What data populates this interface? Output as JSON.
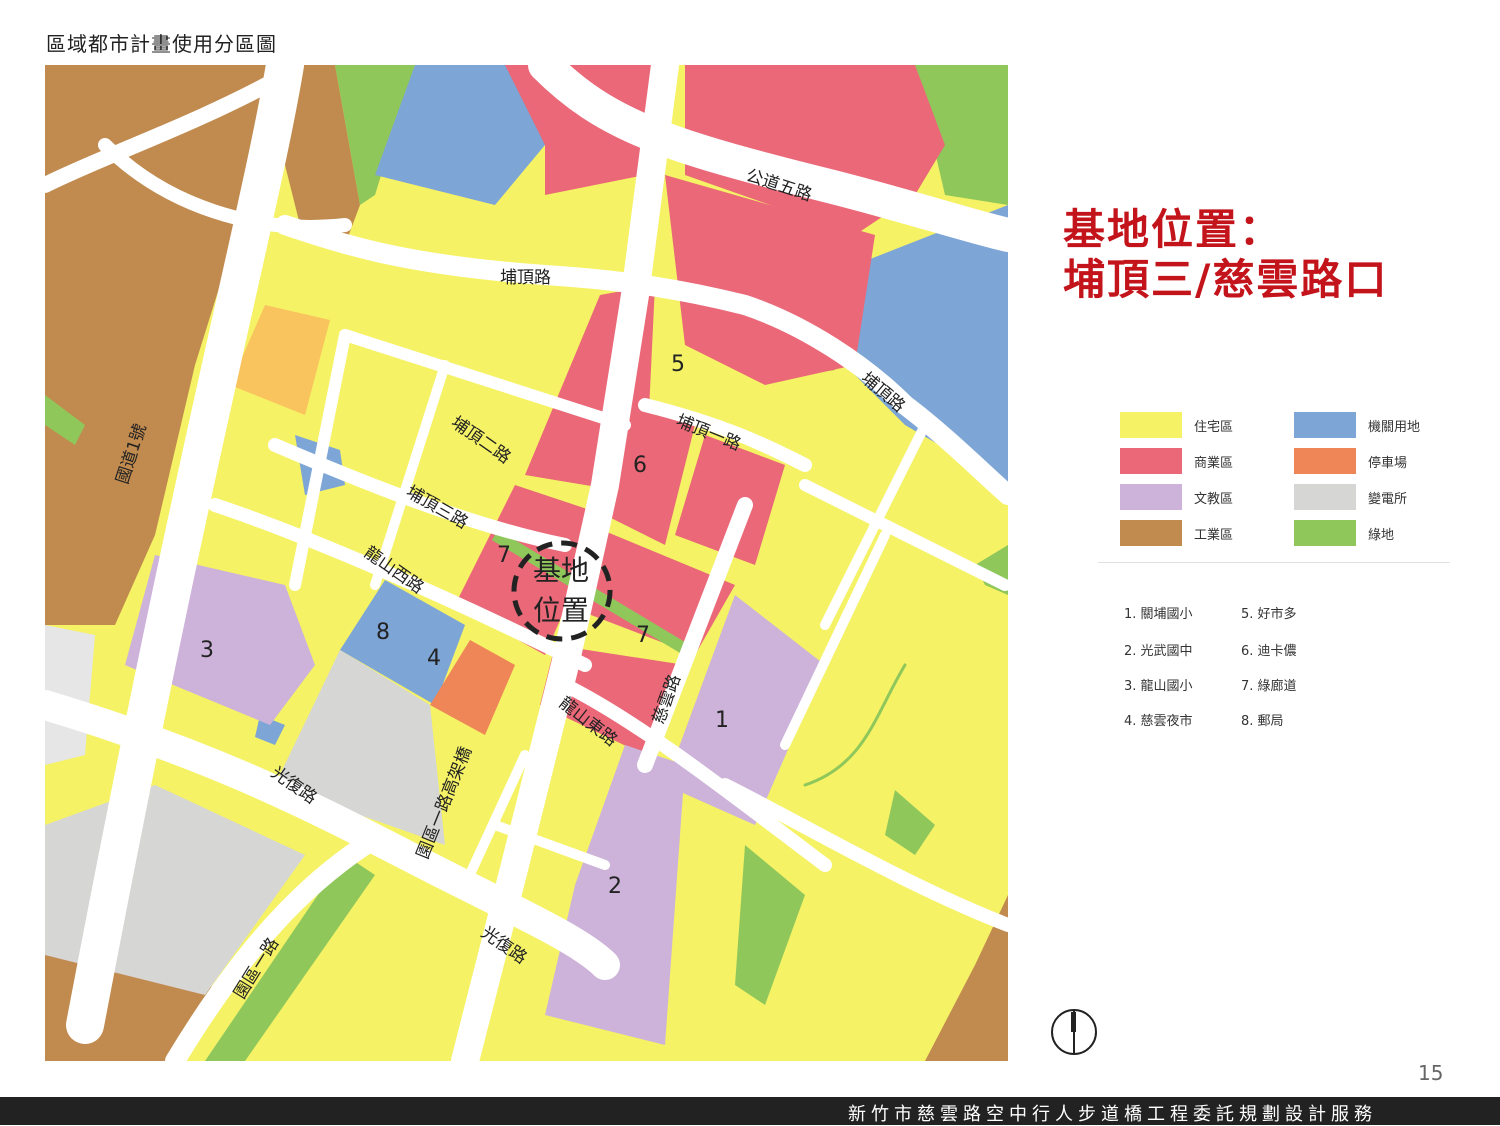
{
  "page_title": "區域都市計畫使用分區圖",
  "site": {
    "line1": "基地位置：",
    "line2": "埔頂三/慈雲路口",
    "map_line1": "基地",
    "map_line2": "位置"
  },
  "colors": {
    "residential": "#f5f266",
    "government": "#7da5d6",
    "commercial": "#ea6878",
    "parking": "#ef8657",
    "education": "#cdb3d9",
    "substation": "#d6d6d4",
    "industrial": "#c18a4e",
    "green": "#8fc75b",
    "road": "#ffffff",
    "orange_lot": "#f9c35e"
  },
  "legend": [
    {
      "label": "住宅區",
      "color": "#f5f266"
    },
    {
      "label": "機關用地",
      "color": "#7da5d6"
    },
    {
      "label": "商業區",
      "color": "#ea6878"
    },
    {
      "label": "停車場",
      "color": "#ef8657"
    },
    {
      "label": "文教區",
      "color": "#cdb3d9"
    },
    {
      "label": "變電所",
      "color": "#d6d6d4"
    },
    {
      "label": "工業區",
      "color": "#c18a4e"
    },
    {
      "label": "綠地",
      "color": "#8fc75b"
    }
  ],
  "poi": [
    "1. 關埔國小",
    "5. 好市多",
    "2. 光武國中",
    "6. 迪卡儂",
    "3. 龍山國小",
    "7. 綠廊道",
    "4. 慈雲夜市",
    "8. 郵局"
  ],
  "roads": {
    "gongdao5": "公道五路",
    "buding": "埔頂路",
    "buding_right": "埔頂路",
    "buding1": "埔頂一路",
    "buding2": "埔頂二路",
    "buding3": "埔頂三路",
    "longshan_west": "龍山西路",
    "longshan_east": "龍山東路",
    "ciyun": "慈雲路",
    "guangfu_left": "光復路",
    "guangfu_bottom": "光復路",
    "yuanqu1": "園區一路",
    "yuanqu1_viaduct": "園區一路高架橋",
    "national1": "國道1號"
  },
  "zone_numbers": {
    "n1": "1",
    "n2": "2",
    "n3": "3",
    "n4": "4",
    "n5": "5",
    "n6": "6",
    "n7a": "7",
    "n7b": "7",
    "n8": "8"
  },
  "page_number": "15",
  "footer": "新竹市慈雲路空中行人步道橋工程委託規劃設計服務"
}
